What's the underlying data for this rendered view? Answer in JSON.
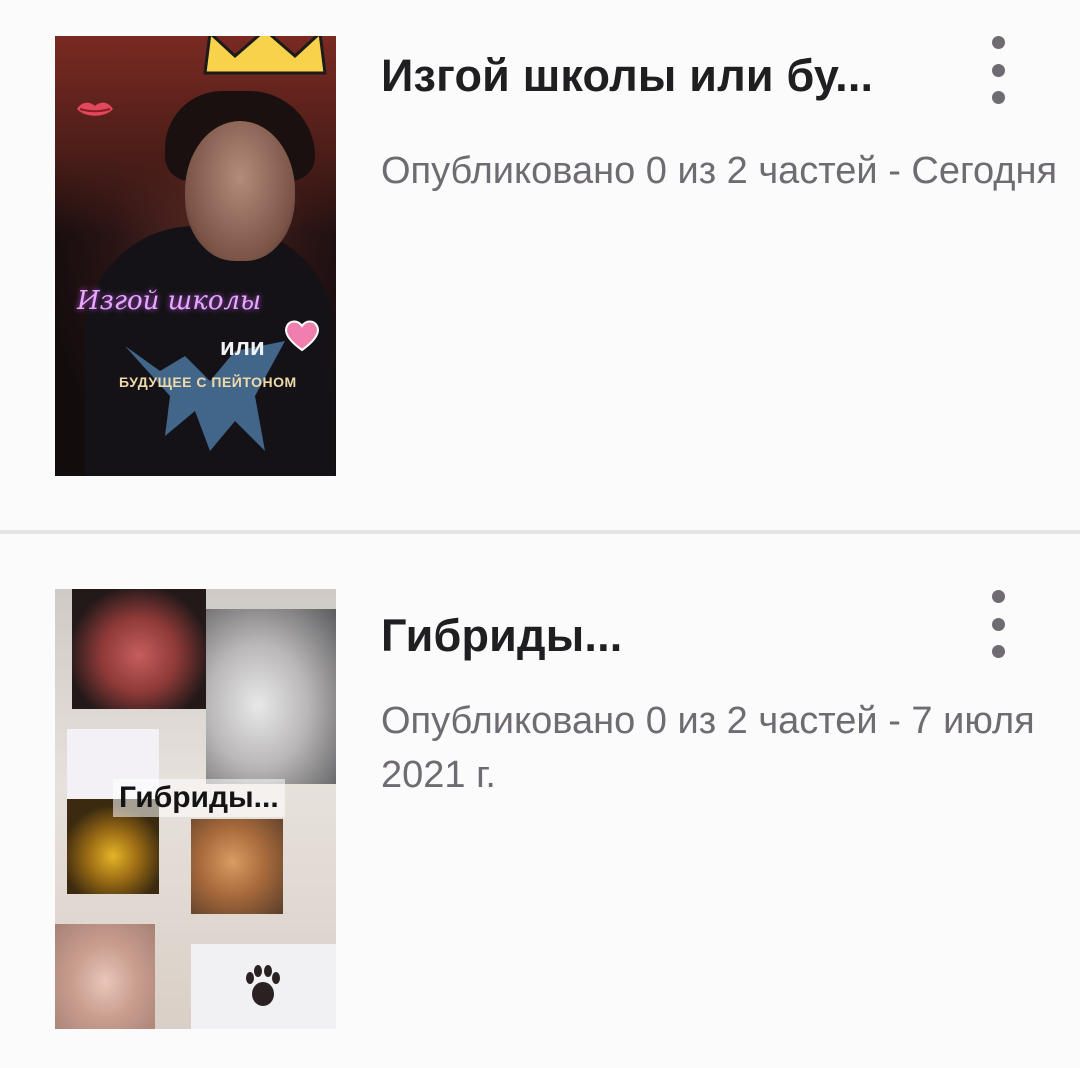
{
  "stories": [
    {
      "title": "Изгой школы или бу...",
      "meta": "Опубликовано 0 из 2 частей - Сегодня",
      "cover_lines": [
        "Изгой школы",
        "или",
        "БУДУЩЕЕ С ПЕЙТОНОМ"
      ]
    },
    {
      "title": "Гибриды...",
      "meta": "Опубликовано 0 из 2 частей - 7 июля 2021 г.",
      "cover_lines": [
        "Гибриды..."
      ]
    }
  ],
  "icons": {
    "more": "more-vertical-icon"
  },
  "colors": {
    "background": "#fcfbfc",
    "title": "#1f1f22",
    "meta": "#6f6b73",
    "divider": "#e6e4e7"
  }
}
